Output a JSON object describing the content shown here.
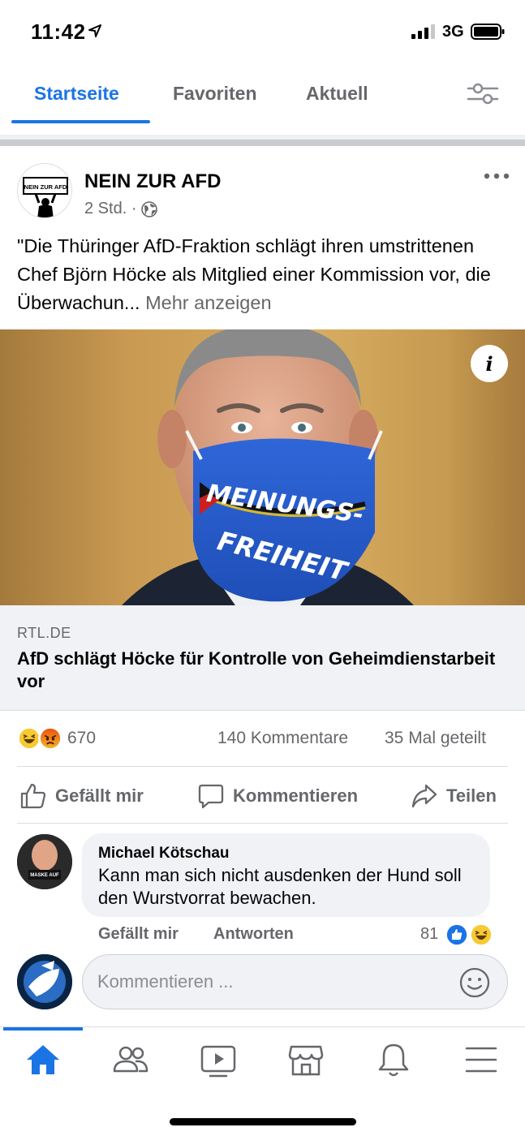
{
  "status_bar": {
    "time": "11:42",
    "network": "3G"
  },
  "tabs": [
    {
      "label": "Startseite",
      "active": true
    },
    {
      "label": "Favoriten",
      "active": false
    },
    {
      "label": "Aktuell",
      "active": false
    }
  ],
  "post": {
    "author": "NEIN ZUR AFD",
    "time": "2 Std. ·",
    "text": "\"Die Thüringer AfD-Fraktion schlägt ihren umstrittenen Chef Björn Höcke als Mitglied einer Kommission vor, die Überwachun...",
    "see_more": "Mehr anzeigen",
    "avatar_sign": "NEIN ZUR AFD",
    "image": {
      "mask_text_top": "MEINUNGS-",
      "mask_text_bottom": "FREIHEIT"
    },
    "link": {
      "domain": "RTL.DE",
      "title": "AfD schlägt Höcke für Kontrolle von Geheimdienstarbeit vor"
    },
    "reactions": {
      "count": "670",
      "types": [
        "haha",
        "angry"
      ]
    },
    "comments_count": "140 Kommentare",
    "shares_count": "35 Mal geteilt",
    "actions": {
      "like": "Gefällt mir",
      "comment": "Kommentieren",
      "share": "Teilen"
    }
  },
  "comment": {
    "author": "Michael Kötschau",
    "text": "Kann man sich nicht ausdenken der Hund soll den Wurstvorrat bewachen.",
    "like": "Gefällt mir",
    "reply": "Antworten",
    "reaction_count": "81",
    "reaction_types": [
      "like",
      "haha"
    ],
    "avatar_badge": "MASKE AUF"
  },
  "composer": {
    "placeholder": "Kommentieren ..."
  },
  "colors": {
    "accent": "#1b74e4",
    "secondary_text": "#65676b",
    "bubble": "#f0f2f5"
  },
  "bottom_nav": [
    {
      "icon": "home-icon",
      "active": true
    },
    {
      "icon": "friends-icon",
      "active": false
    },
    {
      "icon": "watch-icon",
      "active": false
    },
    {
      "icon": "marketplace-icon",
      "active": false
    },
    {
      "icon": "notifications-icon",
      "active": false
    },
    {
      "icon": "menu-icon",
      "active": false
    }
  ]
}
